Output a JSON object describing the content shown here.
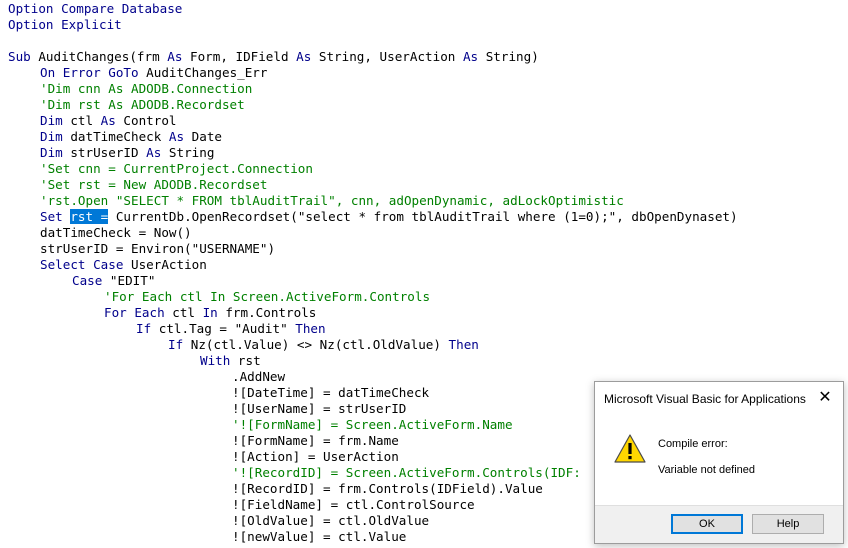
{
  "code": {
    "line01": {
      "kw": "Option Compare Database"
    },
    "line02": {
      "kw": "Option Explicit"
    },
    "line04": {
      "kw1": "Sub",
      "t1": " AuditChanges(frm ",
      "kw2": "As",
      "t2": " Form, IDField ",
      "kw3": "As",
      "t3": " String, UserAction ",
      "kw4": "As",
      "t4": " String)"
    },
    "line05": {
      "kw1": "On Error GoTo",
      "t1": " AuditChanges_Err"
    },
    "line06": {
      "cm": "'Dim cnn As ADODB.Connection"
    },
    "line07": {
      "cm": "'Dim rst As ADODB.Recordset"
    },
    "line08": {
      "kw1": "Dim",
      "t1": " ctl ",
      "kw2": "As",
      "t2": " Control"
    },
    "line09": {
      "kw1": "Dim",
      "t1": " datTimeCheck ",
      "kw2": "As",
      "t2": " Date"
    },
    "line10": {
      "kw1": "Dim",
      "t1": " strUserID ",
      "kw2": "As",
      "t2": " String"
    },
    "line11": {
      "cm": "'Set cnn = CurrentProject.Connection"
    },
    "line12": {
      "cm": "'Set rst = New ADODB.Recordset"
    },
    "line13": {
      "cm": "'rst.Open \"SELECT * FROM tblAuditTrail\", cnn, adOpenDynamic, adLockOptimistic"
    },
    "line14": {
      "kw1": "Set",
      "sel": "rst =",
      "t1": " CurrentDb.OpenRecordset(\"select * from tblAuditTrail where (1=0);\", dbOpenDynaset)"
    },
    "line15": {
      "t1": "datTimeCheck = Now()"
    },
    "line16": {
      "t1": "strUserID = Environ(\"USERNAME\")"
    },
    "line17": {
      "kw1": "Select Case",
      "t1": " UserAction"
    },
    "line18": {
      "kw1": "Case",
      "t1": " \"EDIT\""
    },
    "line19": {
      "cm": "'For Each ctl In Screen.ActiveForm.Controls"
    },
    "line20": {
      "kw1": "For Each",
      "t1": " ctl ",
      "kw2": "In",
      "t2": " frm.Controls"
    },
    "line21": {
      "kw1": "If",
      "t1": " ctl.Tag = \"Audit\" ",
      "kw2": "Then"
    },
    "line22": {
      "kw1": "If",
      "t1": " Nz(ctl.Value) <> Nz(ctl.OldValue) ",
      "kw2": "Then"
    },
    "line23": {
      "kw1": "With",
      "t1": " rst"
    },
    "line24": {
      "t1": ".AddNew"
    },
    "line25": {
      "t1": "![DateTime] = datTimeCheck"
    },
    "line26": {
      "t1": "![UserName] = strUserID"
    },
    "line27": {
      "cm": "'![FormName] = Screen.ActiveForm.Name"
    },
    "line28": {
      "t1": "![FormName] = frm.Name"
    },
    "line29": {
      "t1": "![Action] = UserAction"
    },
    "line30": {
      "cm": "'![RecordID] = Screen.ActiveForm.Controls(IDF:"
    },
    "line31": {
      "t1": "![RecordID] = frm.Controls(IDField).Value"
    },
    "line32": {
      "t1": "![FieldName] = ctl.ControlSource"
    },
    "line33": {
      "t1": "![OldValue] = ctl.OldValue"
    },
    "line34": {
      "t1": "![newValue] = ctl.Value"
    }
  },
  "dialog": {
    "title": "Microsoft Visual Basic for Applications",
    "close_icon": "close-icon",
    "icon": "warning-icon",
    "message_line1": "Compile error:",
    "message_line2": "Variable not defined",
    "ok_label": "OK",
    "help_label": "Help"
  },
  "colors": {
    "keyword": "#00008b",
    "comment": "#008000",
    "selection": "#0078d7",
    "text": "#000000"
  }
}
